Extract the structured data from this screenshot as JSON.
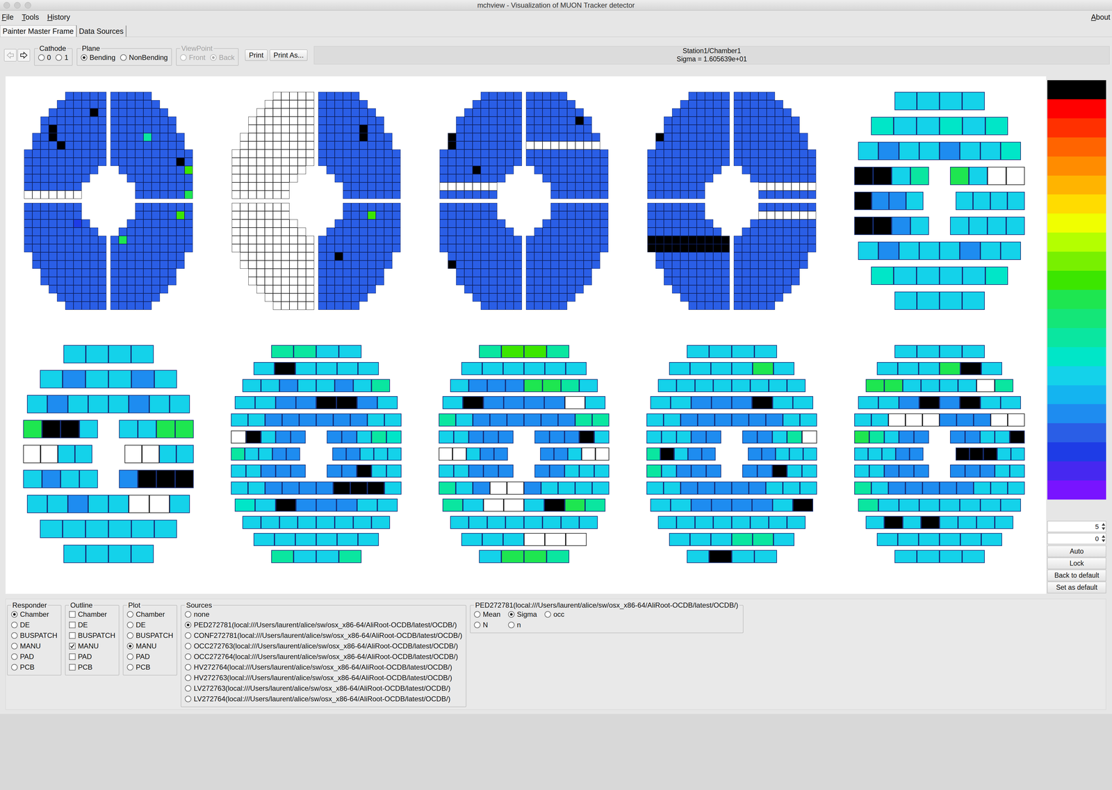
{
  "window": {
    "title": "mchview - Visualization of MUON Tracker detector"
  },
  "menu": [
    "File",
    "Tools",
    "History"
  ],
  "about": "About",
  "tabs": [
    {
      "label": "Painter Master Frame",
      "selected": true
    },
    {
      "label": "Data Sources",
      "selected": false
    }
  ],
  "nav": [
    {
      "disabled": true
    },
    {
      "disabled": false
    }
  ],
  "toolbar": {
    "cathode": {
      "title": "Cathode",
      "options": [
        {
          "label": "0",
          "selected": false
        },
        {
          "label": "1",
          "selected": false
        }
      ]
    },
    "plane": {
      "title": "Plane",
      "options": [
        {
          "label": "Bending",
          "selected": true
        },
        {
          "label": "NonBending",
          "selected": false
        }
      ]
    },
    "viewpoint": {
      "title": "ViewPoint",
      "disabled": true,
      "options": [
        {
          "label": "Front",
          "selected": false
        },
        {
          "label": "Back",
          "selected": true
        }
      ]
    },
    "buttons": [
      "Print",
      "Print As..."
    ],
    "info": [
      "Station1/Chamber1",
      "Sigma = 1.605639e+01"
    ]
  },
  "scale": {
    "steps": [
      "#000000",
      "#ff0000",
      "#ff3000",
      "#ff6400",
      "#ff8c00",
      "#ffb400",
      "#ffdc00",
      "#f0ff00",
      "#b4ff00",
      "#78f000",
      "#3ce600",
      "#1ee650",
      "#14e678",
      "#0ae6a0",
      "#00e6c8",
      "#14d2ea",
      "#14b4f0",
      "#1e8cf0",
      "#2a5ee6",
      "#1e3ce6",
      "#4628f0",
      "#7814ff"
    ],
    "spin": [
      "5",
      "0"
    ],
    "buttons": [
      "Auto",
      "Lock",
      "Back to default",
      "Set as default"
    ]
  },
  "chambers": [
    {
      "kind": "quadrant",
      "quadrants": [
        {
          "value": 0.8,
          "hot": [
            [
              4,
              3,
              9
            ],
            [
              5,
              3,
              9
            ],
            [
              6,
              4,
              9
            ],
            [
              2,
              8,
              9
            ]
          ],
          "bands": [
            [
              12,
              null
            ]
          ]
        },
        {
          "value": 0.8,
          "hot": [
            [
              5,
              4,
              2.0
            ],
            [
              8,
              8,
              9
            ],
            [
              9,
              9,
              2.7
            ],
            [
              12,
              9,
              2.4
            ]
          ],
          "bands": []
        },
        {
          "value": 0.8,
          "hot": [
            [
              2,
              6,
              0.5
            ]
          ],
          "bands": []
        },
        {
          "value": 0.8,
          "hot": [
            [
              1,
              8,
              2.7
            ],
            [
              4,
              1,
              2.4
            ]
          ],
          "bands": []
        }
      ]
    },
    {
      "kind": "quadrant",
      "quadrants": [
        {
          "value": null,
          "hot": [],
          "bands": []
        },
        {
          "value": 0.8,
          "hot": [
            [
              4,
              5,
              9
            ],
            [
              5,
              5,
              9
            ]
          ],
          "bands": []
        },
        {
          "value": null,
          "hot": [],
          "bands": []
        },
        {
          "value": 0.8,
          "hot": [
            [
              1,
              6,
              2.7
            ],
            [
              6,
              2,
              9
            ]
          ],
          "bands": []
        }
      ]
    },
    {
      "kind": "quadrant",
      "quadrants": [
        {
          "value": 0.8,
          "hot": [
            [
              5,
              1,
              9
            ],
            [
              6,
              1,
              9
            ],
            [
              9,
              4,
              9
            ]
          ],
          "bands": [
            [
              11,
              null
            ]
          ]
        },
        {
          "value": 0.8,
          "hot": [
            [
              3,
              6,
              9
            ]
          ],
          "bands": [
            [
              6,
              null
            ]
          ]
        },
        {
          "value": 0.8,
          "hot": [
            [
              7,
              1,
              9
            ]
          ],
          "bands": []
        },
        {
          "value": 0.8,
          "hot": [],
          "bands": []
        }
      ]
    },
    {
      "kind": "quadrant",
      "quadrants": [
        {
          "value": 0.8,
          "hot": [
            [
              5,
              1,
              9
            ]
          ],
          "bands": []
        },
        {
          "value": 0.8,
          "hot": [],
          "bands": [
            [
              11,
              null
            ]
          ]
        },
        {
          "value": 0.8,
          "hot": [],
          "bands": [
            [
              4,
              9
            ],
            [
              5,
              9
            ]
          ]
        },
        {
          "value": 0.8,
          "hot": [],
          "bands": [
            [
              1,
              null
            ]
          ]
        }
      ]
    },
    {
      "kind": "slat",
      "slats": [
        [
          1.5,
          1.5,
          1.5,
          1.5
        ],
        [
          1.8,
          1.5,
          1.5,
          1.8,
          1.5,
          1.8
        ],
        [
          1.5,
          1.1,
          1.5,
          1.5,
          1.1,
          1.5,
          1.5,
          1.8
        ],
        [
          9,
          9,
          1.5,
          2.0,
          2.4,
          1.5,
          null,
          null
        ],
        [
          9,
          1.1,
          1.1,
          1.5,
          1.5,
          1.5,
          1.5,
          1.5
        ],
        [
          9,
          9,
          1.1,
          1.5,
          1.5,
          1.5,
          1.5,
          1.5
        ],
        [
          1.5,
          1.1,
          1.5,
          1.5,
          1.5,
          1.1,
          1.5,
          1.5
        ],
        [
          1.8,
          1.5,
          1.5,
          1.5,
          1.5,
          1.8
        ],
        [
          1.5,
          1.5,
          1.5,
          1.5
        ]
      ]
    },
    {
      "kind": "slat",
      "slats": [
        [
          1.5,
          1.5,
          1.5,
          1.5
        ],
        [
          1.5,
          1.1,
          1.5,
          1.5,
          1.1,
          1.5
        ],
        [
          1.5,
          1.1,
          1.5,
          1.5,
          1.5,
          1.1,
          1.5,
          1.5
        ],
        [
          2.4,
          9,
          9,
          1.5,
          1.5,
          1.5,
          2.4,
          2.4
        ],
        [
          null,
          null,
          1.5,
          1.5,
          null,
          null,
          1.5,
          1.5
        ],
        [
          1.5,
          1.1,
          1.5,
          1.5,
          1.1,
          9,
          9,
          9
        ],
        [
          1.5,
          1.5,
          1.1,
          1.5,
          1.5,
          null,
          null,
          1.5
        ],
        [
          1.5,
          1.5,
          1.5,
          1.5,
          1.5,
          1.5
        ],
        [
          1.5,
          1.5,
          1.5,
          1.5
        ]
      ]
    },
    {
      "kind": "slat",
      "slats": [
        [
          2.0,
          2.0,
          1.5,
          1.5
        ],
        [
          1.5,
          9,
          1.5,
          1.5,
          1.5,
          1.5
        ],
        [
          1.5,
          1.5,
          1.1,
          1.5,
          1.5,
          1.1,
          1.5,
          2.0
        ],
        [
          1.5,
          1.5,
          1.1,
          1.1,
          9,
          9,
          1.1,
          1.5
        ],
        [
          1.5,
          1.5,
          1.1,
          1.1,
          1.1,
          1.1,
          1.1,
          1.1,
          1.5,
          1.5
        ],
        [
          null,
          9,
          1.5,
          1.1,
          1.1,
          1.1,
          1.1,
          1.5,
          2.0,
          1.8
        ],
        [
          2.0,
          1.5,
          1.5,
          1.1,
          1.1,
          1.1,
          1.1,
          1.5,
          1.5,
          1.5
        ],
        [
          1.5,
          1.5,
          1.1,
          1.1,
          1.1,
          1.1,
          1.1,
          9,
          1.5,
          1.5
        ],
        [
          1.5,
          1.5,
          1.1,
          1.1,
          1.1,
          1.1,
          9,
          9,
          9,
          1.5
        ],
        [
          1.8,
          1.5,
          9,
          1.1,
          1.1,
          1.1,
          1.5,
          1.5
        ],
        [
          1.5,
          1.5,
          1.5,
          1.5,
          1.5,
          1.5,
          1.5,
          1.5
        ],
        [
          1.5,
          1.5,
          1.5,
          1.5,
          1.5,
          1.5
        ],
        [
          2.0,
          1.5,
          1.5,
          2.0
        ]
      ]
    },
    {
      "kind": "slat",
      "slats": [
        [
          2.0,
          2.7,
          2.7,
          2.0
        ],
        [
          1.5,
          1.5,
          1.5,
          1.5,
          1.5,
          1.5
        ],
        [
          1.5,
          1.1,
          1.1,
          1.1,
          2.4,
          2.4,
          2.0,
          1.5
        ],
        [
          1.5,
          9,
          1.1,
          1.1,
          1.1,
          1.1,
          null,
          1.5
        ],
        [
          2.0,
          1.5,
          1.1,
          1.1,
          1.1,
          1.1,
          1.1,
          1.1,
          2.0,
          2.0
        ],
        [
          1.5,
          1.5,
          1.1,
          1.1,
          1.1,
          1.1,
          1.1,
          1.1,
          9,
          1.5
        ],
        [
          null,
          null,
          1.5,
          1.1,
          1.1,
          1.1,
          1.1,
          1.5,
          null,
          null
        ],
        [
          1.5,
          1.5,
          1.1,
          1.1,
          1.1,
          1.1,
          1.1,
          1.5,
          1.5,
          1.5
        ],
        [
          2.0,
          1.5,
          1.1,
          null,
          null,
          1.1,
          1.5,
          1.5,
          1.5,
          1.5
        ],
        [
          2.0,
          1.5,
          null,
          null,
          1.5,
          9,
          2.4,
          2.0
        ],
        [
          1.5,
          1.5,
          1.5,
          1.5,
          1.5,
          1.5,
          1.5,
          1.5
        ],
        [
          1.5,
          1.5,
          1.5,
          null,
          null,
          null
        ],
        [
          1.5,
          2.4,
          2.4,
          2.0
        ]
      ]
    },
    {
      "kind": "slat",
      "slats": [
        [
          1.5,
          1.5,
          1.5,
          1.5
        ],
        [
          1.5,
          1.5,
          1.5,
          1.5,
          2.4,
          1.5
        ],
        [
          1.5,
          1.5,
          1.5,
          1.5,
          1.5,
          1.5,
          1.5,
          1.5
        ],
        [
          1.5,
          1.5,
          1.1,
          1.1,
          1.1,
          9,
          1.5,
          1.5
        ],
        [
          1.5,
          1.5,
          1.1,
          1.1,
          1.1,
          1.1,
          1.1,
          1.1,
          1.5,
          1.5
        ],
        [
          1.5,
          1.5,
          1.5,
          1.1,
          1.1,
          1.1,
          1.1,
          1.5,
          2.0,
          null
        ],
        [
          2.0,
          9,
          1.5,
          1.1,
          1.1,
          1.1,
          1.1,
          1.5,
          1.5,
          1.5
        ],
        [
          2.0,
          1.5,
          1.1,
          1.1,
          1.1,
          1.1,
          1.1,
          9,
          1.5,
          1.5
        ],
        [
          1.5,
          1.5,
          1.1,
          1.1,
          1.1,
          1.1,
          1.1,
          1.5,
          1.5,
          1.5
        ],
        [
          1.5,
          1.5,
          1.1,
          1.1,
          1.1,
          1.1,
          1.5,
          9
        ],
        [
          1.5,
          1.5,
          1.5,
          1.5,
          1.5,
          1.5,
          1.5,
          1.5
        ],
        [
          1.5,
          1.5,
          1.5,
          2.0,
          2.0,
          1.5
        ],
        [
          1.5,
          9,
          1.5,
          1.5
        ]
      ]
    },
    {
      "kind": "slat",
      "slats": [
        [
          1.5,
          1.5,
          1.5,
          1.5
        ],
        [
          1.5,
          1.5,
          1.5,
          2.4,
          9,
          1.5
        ],
        [
          2.4,
          2.4,
          1.5,
          1.5,
          1.5,
          1.5,
          null,
          2.0
        ],
        [
          1.5,
          1.5,
          1.1,
          9,
          1.1,
          9,
          1.5,
          1.5
        ],
        [
          1.5,
          1.5,
          null,
          null,
          null,
          1.1,
          1.1,
          1.1,
          null,
          null
        ],
        [
          2.4,
          2.0,
          1.5,
          1.1,
          1.1,
          1.1,
          1.1,
          1.5,
          1.5,
          9
        ],
        [
          1.5,
          1.5,
          1.5,
          1.1,
          1.1,
          9,
          9,
          9,
          1.5,
          1.5
        ],
        [
          1.5,
          1.5,
          1.1,
          1.1,
          1.1,
          1.1,
          1.1,
          1.1,
          1.5,
          1.5
        ],
        [
          2.0,
          1.5,
          1.1,
          1.1,
          1.1,
          1.1,
          1.1,
          1.5,
          1.5,
          1.5
        ],
        [
          2.0,
          1.5,
          1.5,
          1.5,
          1.5,
          1.5,
          1.5,
          1.5
        ],
        [
          1.5,
          9,
          1.5,
          9,
          1.5,
          1.5,
          1.5,
          1.5
        ],
        [
          1.5,
          1.5,
          1.5,
          1.5,
          1.5,
          1.5
        ],
        [
          1.5,
          1.5,
          1.5,
          1.5
        ]
      ]
    }
  ],
  "panel": {
    "responder": {
      "title": "Responder",
      "options": [
        {
          "label": "Chamber",
          "selected": true
        },
        {
          "label": "DE",
          "selected": false
        },
        {
          "label": "BUSPATCH",
          "selected": false
        },
        {
          "label": "MANU",
          "selected": false
        },
        {
          "label": "PAD",
          "selected": false
        },
        {
          "label": "PCB",
          "selected": false
        }
      ]
    },
    "outline": {
      "title": "Outline",
      "options": [
        {
          "label": "Chamber",
          "checked": false
        },
        {
          "label": "DE",
          "checked": false
        },
        {
          "label": "BUSPATCH",
          "checked": false
        },
        {
          "label": "MANU",
          "checked": true
        },
        {
          "label": "PAD",
          "checked": false
        },
        {
          "label": "PCB",
          "checked": false
        }
      ]
    },
    "plot": {
      "title": "Plot",
      "options": [
        {
          "label": "Chamber",
          "selected": false
        },
        {
          "label": "DE",
          "selected": false
        },
        {
          "label": "BUSPATCH",
          "selected": false
        },
        {
          "label": "MANU",
          "selected": true
        },
        {
          "label": "PAD",
          "selected": false
        },
        {
          "label": "PCB",
          "selected": false
        }
      ]
    },
    "sources": {
      "title": "Sources",
      "options": [
        {
          "label": "none",
          "selected": false
        },
        {
          "label": "PED272781(local:///Users/laurent/alice/sw/osx_x86-64/AliRoot-OCDB/latest/OCDB/)",
          "selected": true
        },
        {
          "label": "CONF272781(local:///Users/laurent/alice/sw/osx_x86-64/AliRoot-OCDB/latest/OCDB/)",
          "selected": false
        },
        {
          "label": "OCC272763(local:///Users/laurent/alice/sw/osx_x86-64/AliRoot-OCDB/latest/OCDB/)",
          "selected": false
        },
        {
          "label": "OCC272764(local:///Users/laurent/alice/sw/osx_x86-64/AliRoot-OCDB/latest/OCDB/)",
          "selected": false
        },
        {
          "label": "HV272764(local:///Users/laurent/alice/sw/osx_x86-64/AliRoot-OCDB/latest/OCDB/)",
          "selected": false
        },
        {
          "label": "HV272763(local:///Users/laurent/alice/sw/osx_x86-64/AliRoot-OCDB/latest/OCDB/)",
          "selected": false
        },
        {
          "label": "LV272763(local:///Users/laurent/alice/sw/osx_x86-64/AliRoot-OCDB/latest/OCDB/)",
          "selected": false
        },
        {
          "label": "LV272764(local:///Users/laurent/alice/sw/osx_x86-64/AliRoot-OCDB/latest/OCDB/)",
          "selected": false
        }
      ]
    },
    "dimension": {
      "title": "PED272781(local:///Users/laurent/alice/sw/osx_x86-64/AliRoot-OCDB/latest/OCDB/)",
      "options": [
        {
          "label": "Mean",
          "selected": false
        },
        {
          "label": "Sigma",
          "selected": true
        },
        {
          "label": "occ",
          "selected": false
        },
        {
          "label": "N",
          "selected": false
        },
        {
          "label": "n",
          "selected": false
        }
      ]
    }
  }
}
